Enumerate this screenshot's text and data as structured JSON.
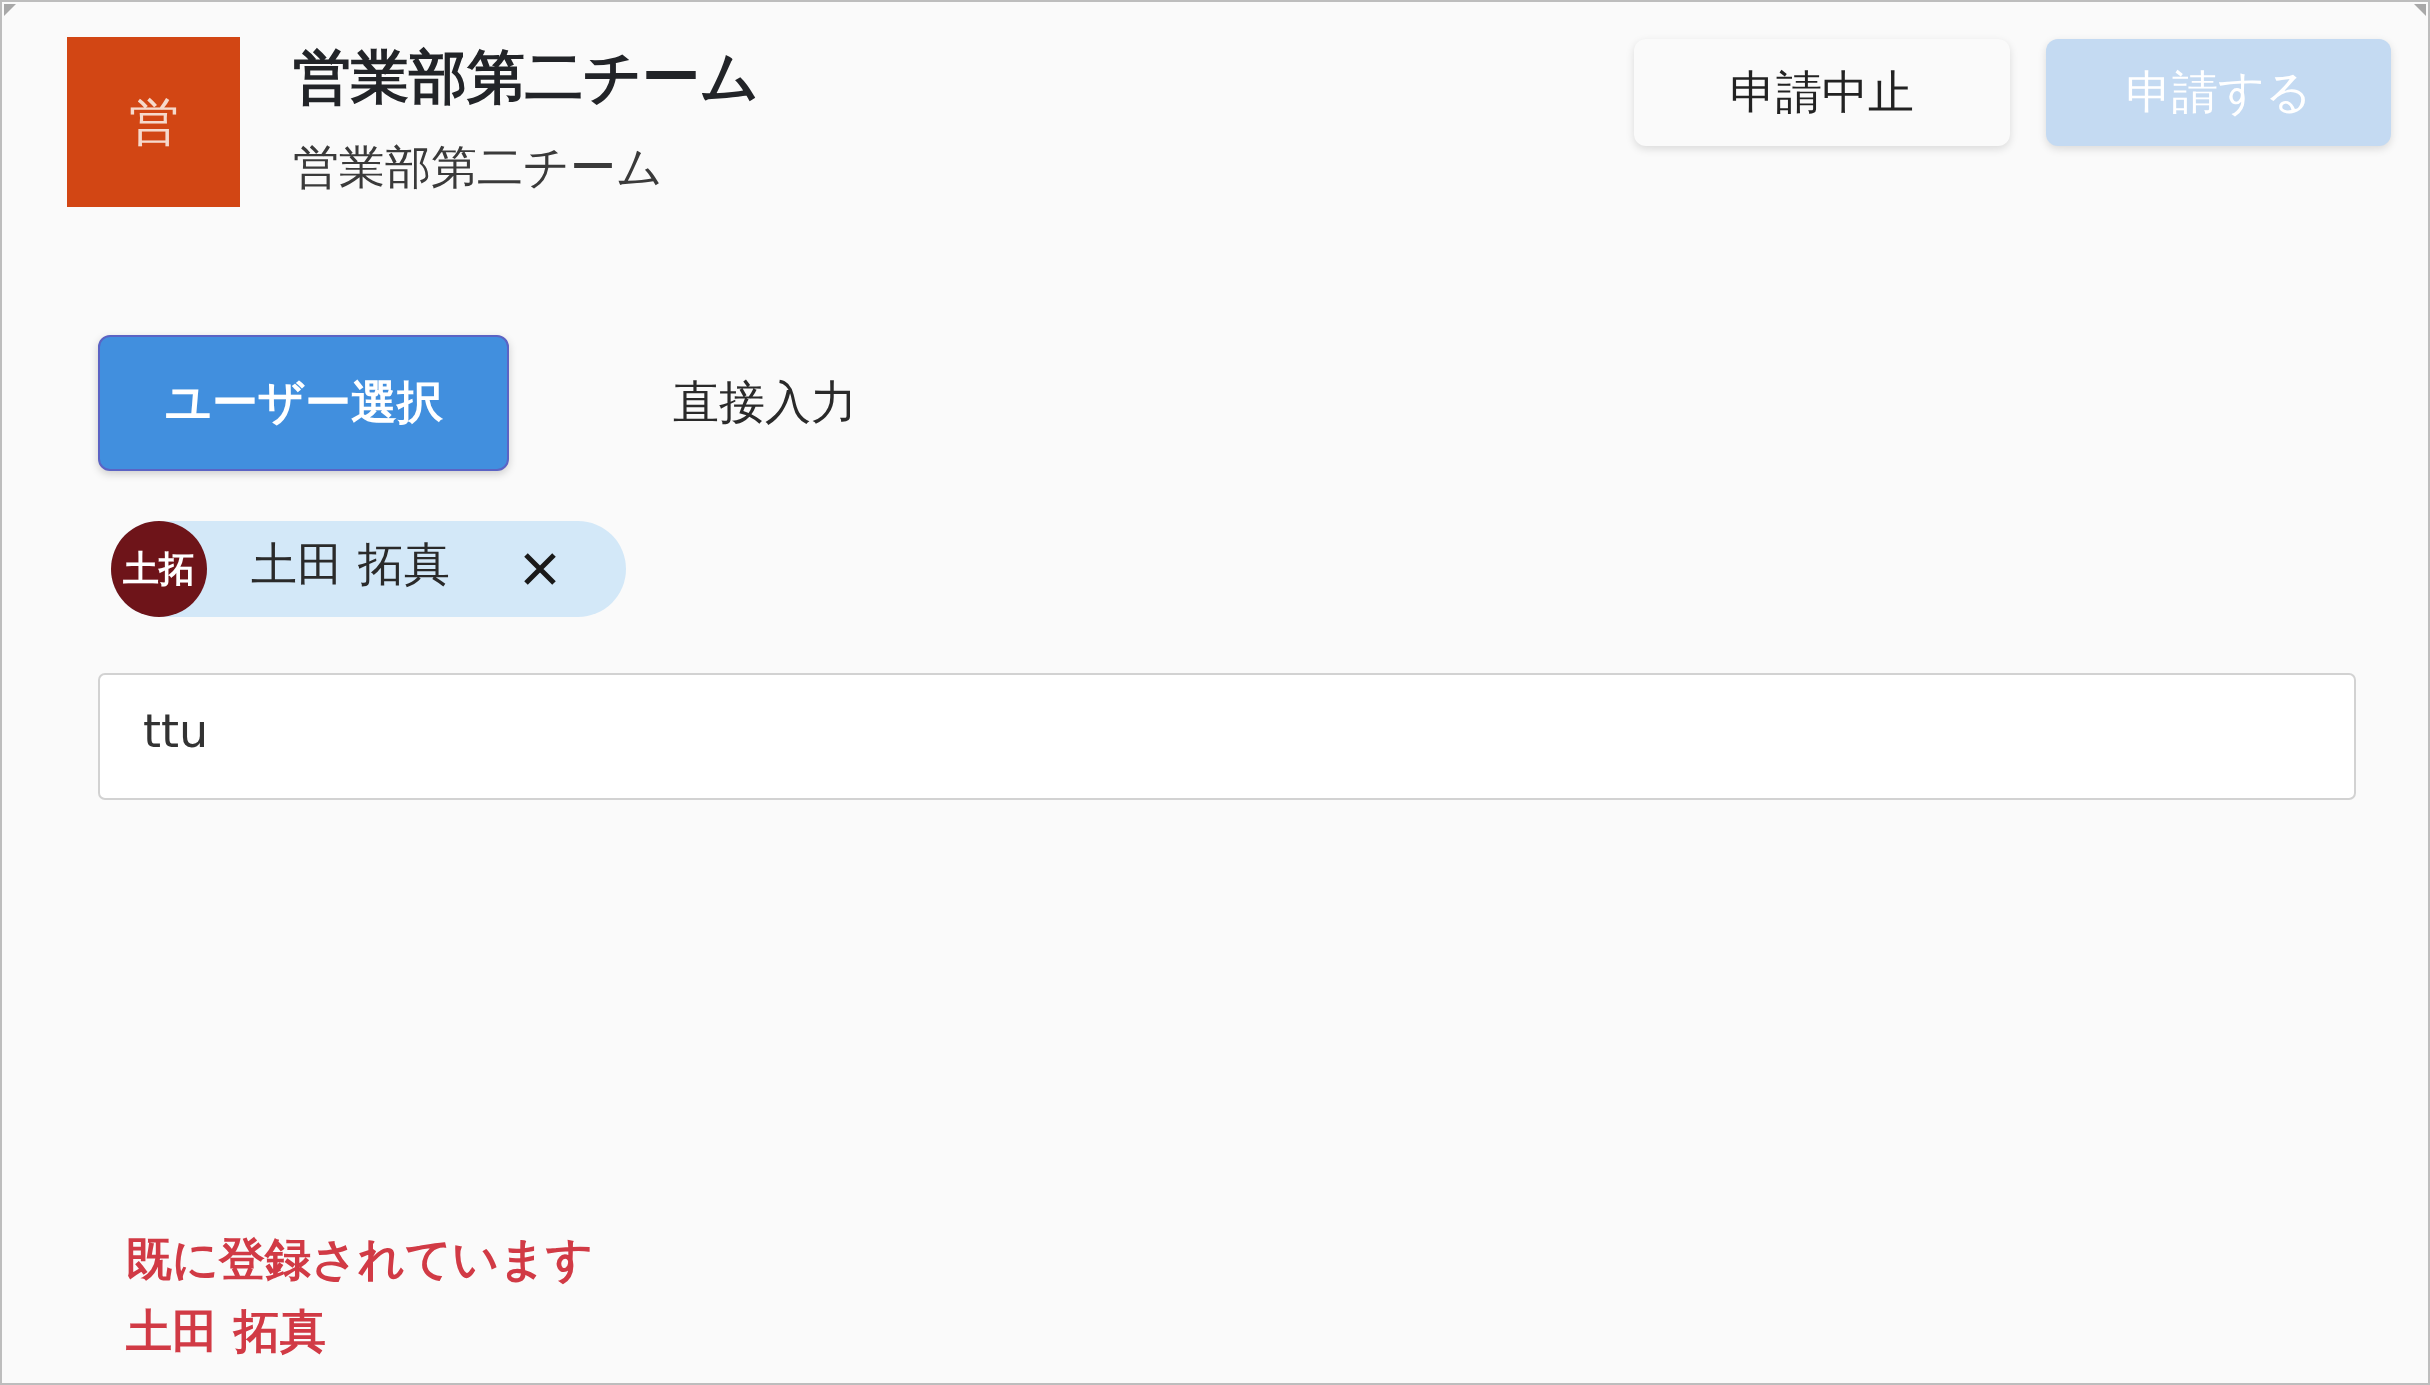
{
  "team": {
    "avatar": "営",
    "name": "営業部第二チーム",
    "subtitle": "営業部第二チーム"
  },
  "actions": [
    {
      "label": "申請中止",
      "kind": "secondary",
      "disabled": false
    },
    {
      "label": "申請する",
      "kind": "primary",
      "disabled": true
    }
  ],
  "tabs": [
    {
      "label": "ユーザー選択",
      "selected": true
    },
    {
      "label": "直接入力",
      "selected": false
    }
  ],
  "selected_users": [
    {
      "initials": "土拓",
      "name": "土田 拓真",
      "color": "#6e1419"
    }
  ],
  "search_field": {
    "value": "ttu"
  },
  "error": {
    "message": "既に登録されています",
    "name": "土田 拓真"
  }
}
